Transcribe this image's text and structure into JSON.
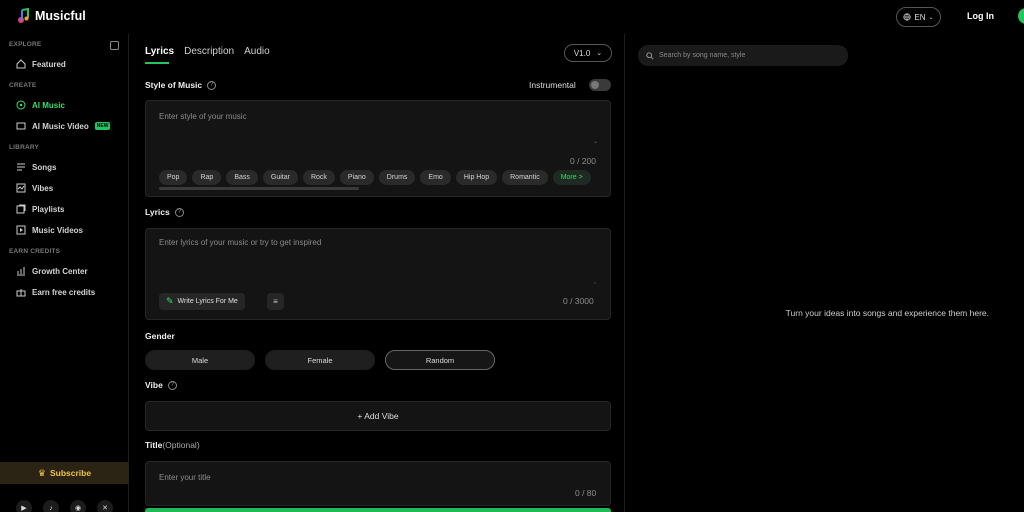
{
  "header": {
    "app_name": "Musicful",
    "lang": "EN",
    "login_label": "Log In"
  },
  "sidebar": {
    "sections": {
      "explore": "EXPLORE",
      "create": "CREATE",
      "library": "LIBRARY",
      "earn": "EARN CREDITS"
    },
    "items": {
      "featured": "Featured",
      "ai_music": "AI Music",
      "ai_music_video": "AI Music Video",
      "new_badge": "NEW",
      "songs": "Songs",
      "vibes": "Vibes",
      "playlists": "Playlists",
      "music_videos": "Music Videos",
      "growth_center": "Growth Center",
      "earn_free_credits": "Earn free credits"
    },
    "subscribe_label": "Subscribe"
  },
  "center": {
    "tabs": [
      "Lyrics",
      "Description",
      "Audio"
    ],
    "version": "V1.0",
    "style": {
      "label": "Style of Music",
      "instrumental_label": "Instrumental",
      "instrumental_on": false,
      "placeholder": "Enter style of your music",
      "counter": "0 / 200",
      "chips": [
        "Pop",
        "Rap",
        "Bass",
        "Guitar",
        "Rock",
        "Piano",
        "Drums",
        "Emo",
        "Hip Hop",
        "Romantic"
      ],
      "more_label": "More >"
    },
    "lyrics": {
      "label": "Lyrics",
      "placeholder": "Enter lyrics of your music or try to get inspired",
      "write_button": "Write Lyrics For Me",
      "counter": "0 / 3000"
    },
    "gender": {
      "label": "Gender",
      "options": [
        "Male",
        "Female",
        "Random"
      ],
      "selected": "Random"
    },
    "vibe": {
      "label": "Vibe",
      "add_label": "+ Add Vibe"
    },
    "title": {
      "label": "Title",
      "optional": "(Optional)",
      "placeholder": "Enter your title",
      "counter": "0 / 80"
    }
  },
  "right": {
    "search_placeholder": "Search by song name, style",
    "empty_message": "Turn your ideas into songs and experience them here."
  },
  "colors": {
    "accent": "#22c55e",
    "subscribe_gold": "#f0c24b",
    "background": "#000000",
    "panel": "#141414"
  }
}
